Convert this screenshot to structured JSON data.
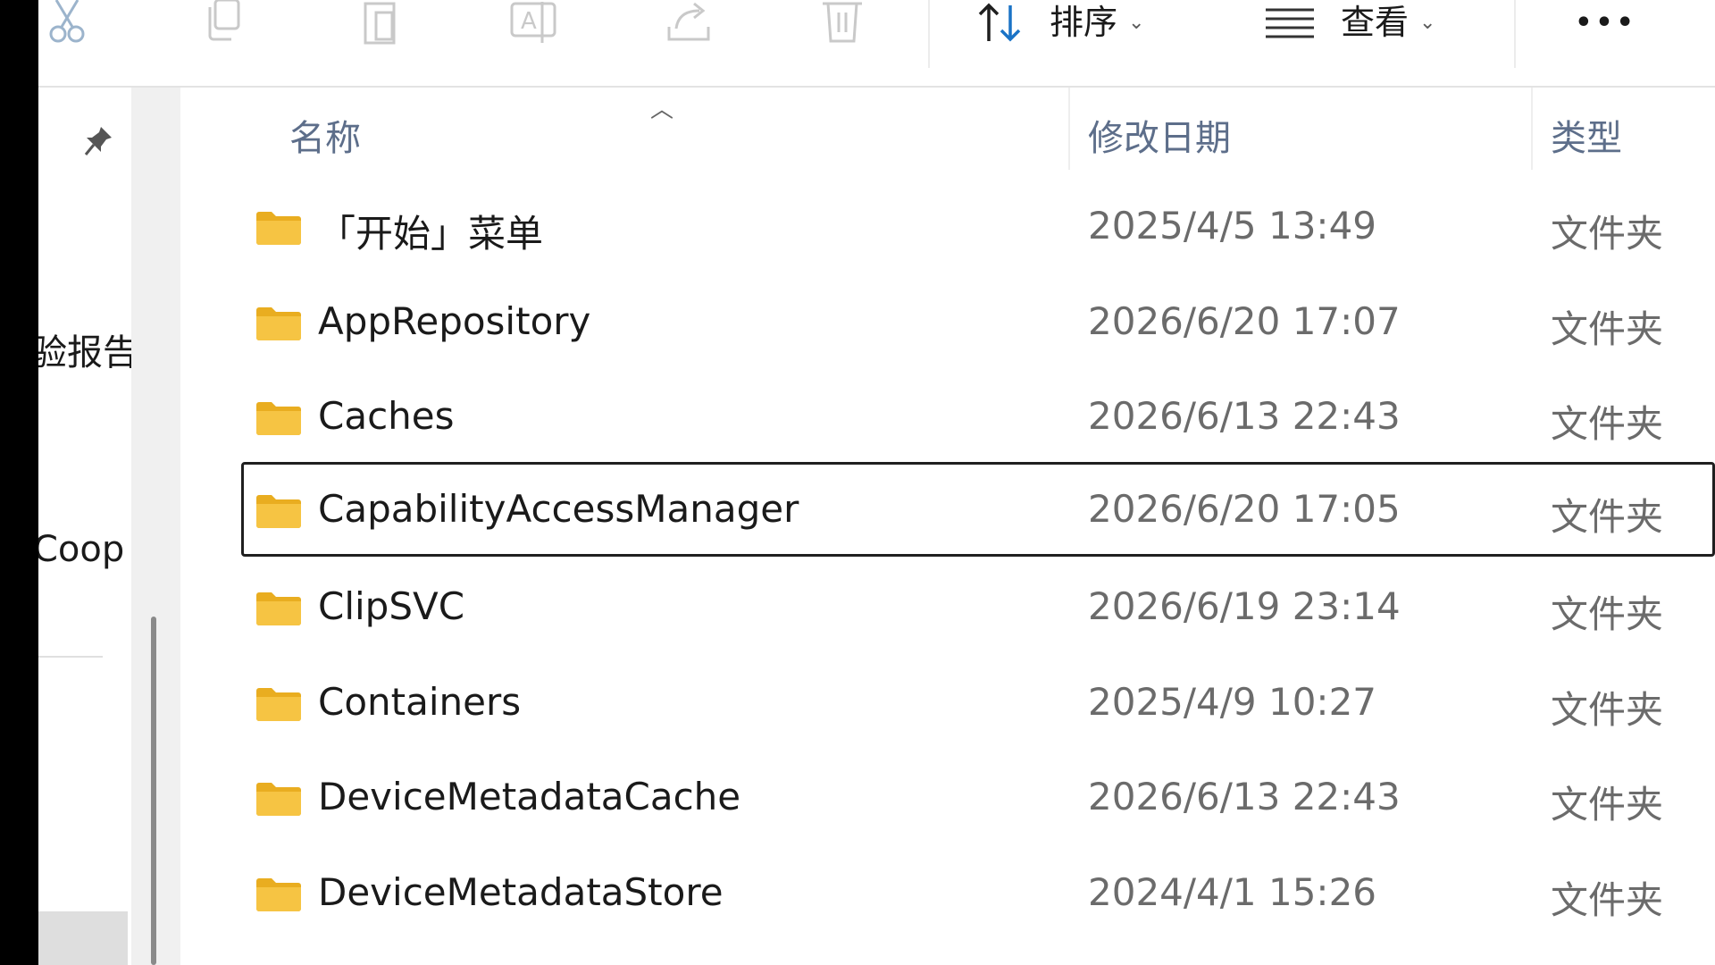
{
  "toolbar": {
    "sort_label": "排序",
    "view_label": "查看",
    "more_label": "•••"
  },
  "nav_pane": {
    "items": [
      {
        "label": "验报告"
      },
      {
        "label": "Coop"
      }
    ]
  },
  "file_list": {
    "columns": {
      "name": "名称",
      "date": "修改日期",
      "type": "类型"
    },
    "rows": [
      {
        "name": "「开始」菜单",
        "date": "2025/4/5 13:49",
        "type": "文件夹"
      },
      {
        "name": "AppRepository",
        "date": "2026/6/20 17:07",
        "type": "文件夹"
      },
      {
        "name": "Caches",
        "date": "2026/6/13 22:43",
        "type": "文件夹"
      },
      {
        "name": "CapabilityAccessManager",
        "date": "2026/6/20 17:05",
        "type": "文件夹"
      },
      {
        "name": "ClipSVC",
        "date": "2026/6/19 23:14",
        "type": "文件夹"
      },
      {
        "name": "Containers",
        "date": "2025/4/9 10:27",
        "type": "文件夹"
      },
      {
        "name": "DeviceMetadataCache",
        "date": "2026/6/13 22:43",
        "type": "文件夹"
      },
      {
        "name": "DeviceMetadataStore",
        "date": "2024/4/1 15:26",
        "type": "文件夹"
      }
    ]
  },
  "colors": {
    "folder_yellow": "#f6c443",
    "folder_back": "#e9ad20",
    "sort_arrow_blue": "#1a73c6",
    "header_text": "#5d6e8a"
  }
}
